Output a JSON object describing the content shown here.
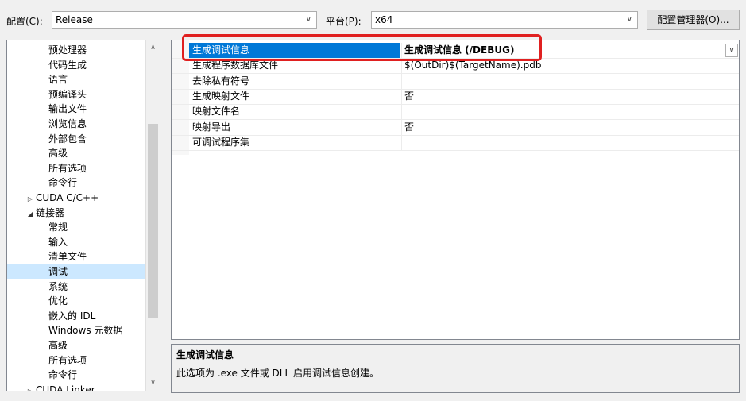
{
  "toolbar": {
    "config_label": "配置(C):",
    "config_value": "Release",
    "platform_label": "平台(P):",
    "platform_value": "x64",
    "config_manager_label": "配置管理器(O)..."
  },
  "tree": {
    "items": [
      {
        "label": "预处理器",
        "level": 2
      },
      {
        "label": "代码生成",
        "level": 2
      },
      {
        "label": "语言",
        "level": 2
      },
      {
        "label": "预编译头",
        "level": 2
      },
      {
        "label": "输出文件",
        "level": 2
      },
      {
        "label": "浏览信息",
        "level": 2
      },
      {
        "label": "外部包含",
        "level": 2
      },
      {
        "label": "高级",
        "level": 2
      },
      {
        "label": "所有选项",
        "level": 2
      },
      {
        "label": "命令行",
        "level": 2
      },
      {
        "label": "CUDA C/C++",
        "level": 1,
        "expander": "▷"
      },
      {
        "label": "链接器",
        "level": 1,
        "expander": "◢"
      },
      {
        "label": "常规",
        "level": 2
      },
      {
        "label": "输入",
        "level": 2
      },
      {
        "label": "清单文件",
        "level": 2
      },
      {
        "label": "调试",
        "level": 2,
        "selected": true
      },
      {
        "label": "系统",
        "level": 2
      },
      {
        "label": "优化",
        "level": 2
      },
      {
        "label": "嵌入的 IDL",
        "level": 2
      },
      {
        "label": "Windows 元数据",
        "level": 2
      },
      {
        "label": "高级",
        "level": 2
      },
      {
        "label": "所有选项",
        "level": 2
      },
      {
        "label": "命令行",
        "level": 2
      },
      {
        "label": "CUDA Linker",
        "level": 1,
        "expander": "▷"
      }
    ]
  },
  "properties": {
    "rows": [
      {
        "name": "生成调试信息",
        "value": "生成调试信息 (/DEBUG)",
        "selected": true
      },
      {
        "name": "生成程序数据库文件",
        "value": "$(OutDir)$(TargetName).pdb"
      },
      {
        "name": "去除私有符号",
        "value": ""
      },
      {
        "name": "生成映射文件",
        "value": "否"
      },
      {
        "name": "映射文件名",
        "value": ""
      },
      {
        "name": "映射导出",
        "value": "否"
      },
      {
        "name": "可调试程序集",
        "value": ""
      }
    ]
  },
  "description": {
    "title": "生成调试信息",
    "text": "此选项为 .exe 文件或 DLL 启用调试信息创建。"
  },
  "colors": {
    "selection": "#0078d7",
    "tree_selection": "#cce8ff",
    "highlight_box": "#e02020"
  }
}
